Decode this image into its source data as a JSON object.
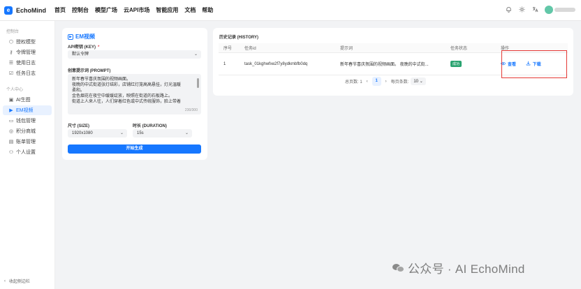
{
  "app": {
    "name": "EchoMind"
  },
  "nav": [
    "首页",
    "控制台",
    "模型广场",
    "云API市场",
    "智能应用",
    "文档",
    "帮助"
  ],
  "top_icons": [
    "bell-icon",
    "sun-icon",
    "translate-icon"
  ],
  "sidebar": {
    "group1": "控制台",
    "items1": [
      {
        "label": "授权模型",
        "icon": "⬡"
      },
      {
        "label": "令牌管理",
        "icon": "⚷"
      },
      {
        "label": "使用日志",
        "icon": "☰"
      },
      {
        "label": "任务日志",
        "icon": "☑"
      }
    ],
    "group2": "个人中心",
    "items2": [
      {
        "label": "AI生图",
        "icon": "▣"
      },
      {
        "label": "EM视频",
        "icon": "▶"
      },
      {
        "label": "钱包管理",
        "icon": "▭"
      },
      {
        "label": "积分商城",
        "icon": "◎"
      },
      {
        "label": "账单管理",
        "icon": "▤"
      },
      {
        "label": "个人设置",
        "icon": "⚇"
      }
    ],
    "active_item": "EM视频",
    "collapse_label": "收起侧边栏"
  },
  "em_card": {
    "title": "EM视频",
    "key_label": "API密钥 (KEY)",
    "key_required": "*",
    "key_value": "默认令牌",
    "prompt_label": "创意提示词 (PROMPT)",
    "prompt_lines": [
      "新年春节喜庆氛围的视频画面。",
      "夜晚的中式街道张灯结彩，店铺红灯笼高高悬挂，灯光温暖",
      "柔和。",
      "金色烟花在夜空中缓缓绽放，映照在街道的石板路上。",
      "街道上人来人往，人们穿着红色或中式传统服饰，脸上带着"
    ],
    "prompt_count": "230/300",
    "size_label": "尺寸 (SIZE)",
    "size_value": "1920x1080",
    "duration_label": "时长 (DURATION)",
    "duration_value": "15s",
    "generate_button": "开始生成"
  },
  "history": {
    "title": "历史记录 (HISTORY)",
    "columns": [
      "序号",
      "任务id",
      "提示词",
      "任务状态",
      "操作"
    ],
    "rows": [
      {
        "index": "1",
        "task_id": "task_01kghwfxe2f7y8ydkmbfb0dq",
        "prompt": "新年春节喜庆氛围的视频画面。 夜晚的中式街...",
        "status": "成功",
        "view": "查看",
        "download": "下载"
      }
    ],
    "pagination": {
      "total": "总页数: 1",
      "current_page": "1",
      "page_size_label": "每页条数:",
      "page_size": "10"
    }
  },
  "watermark": "公众号 · AI EchoMind"
}
